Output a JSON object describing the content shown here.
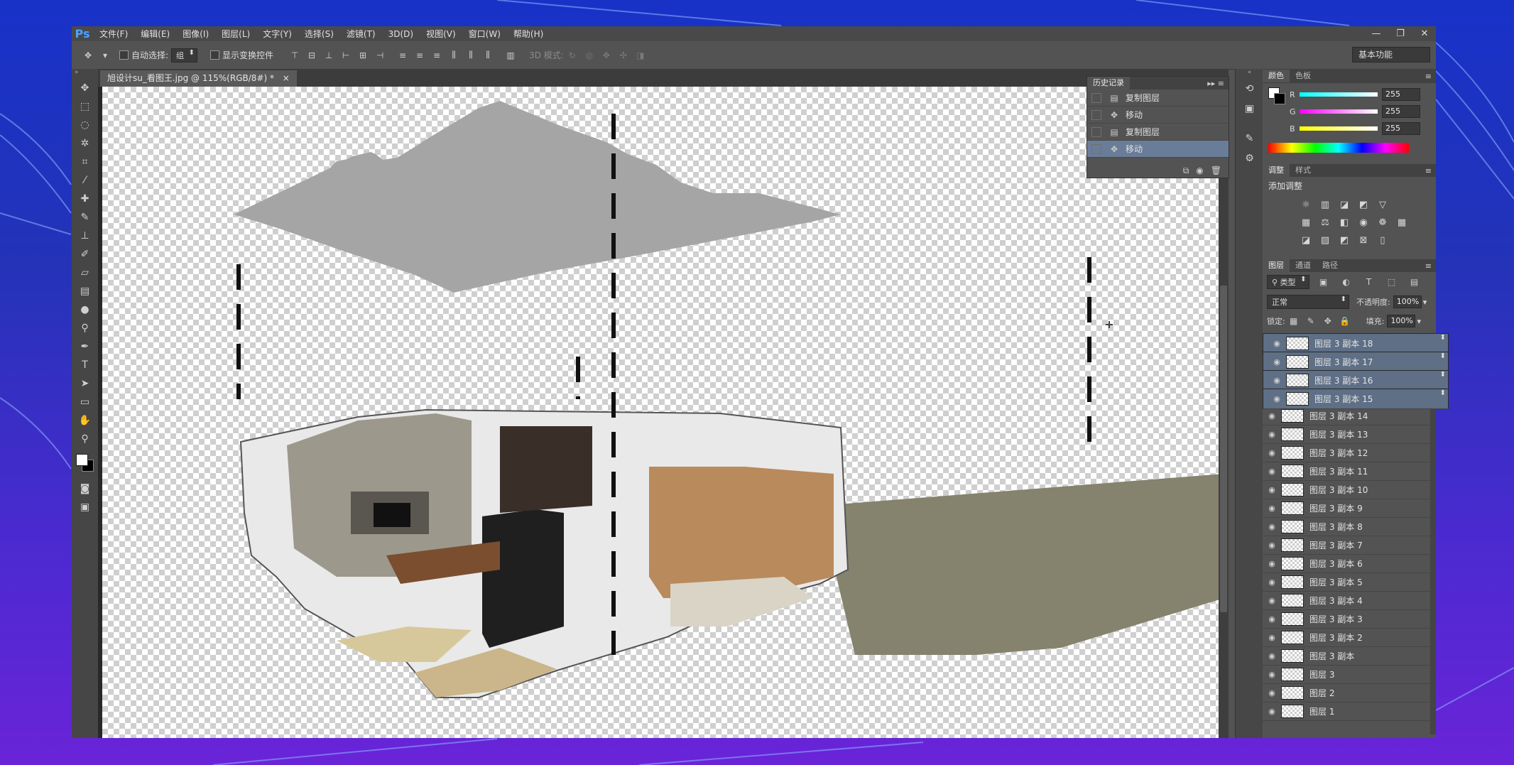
{
  "app": {
    "logo": "Ps",
    "menu": [
      "文件(F)",
      "编辑(E)",
      "图像(I)",
      "图层(L)",
      "文字(Y)",
      "选择(S)",
      "滤镜(T)",
      "3D(D)",
      "视图(V)",
      "窗口(W)",
      "帮助(H)"
    ],
    "window_controls": [
      "—",
      "❐",
      "✕"
    ]
  },
  "options_bar": {
    "auto_select_label": "自动选择:",
    "auto_select_value": "组",
    "show_transform_label": "显示变换控件",
    "mode_3d_label": "3D 模式:",
    "workspace": "基本功能"
  },
  "document": {
    "tab_title": "旭设计su_看图王.jpg @ 115%(RGB/8#) *"
  },
  "history": {
    "tab": "历史记录",
    "items": [
      {
        "label": "复制图层",
        "icon": "document-icon",
        "selected": false
      },
      {
        "label": "移动",
        "icon": "move-icon",
        "selected": false
      },
      {
        "label": "复制图层",
        "icon": "document-icon",
        "selected": false
      },
      {
        "label": "移动",
        "icon": "move-icon",
        "selected": true
      }
    ]
  },
  "color_panel": {
    "tabs": [
      "颜色",
      "色板"
    ],
    "r_label": "R",
    "g_label": "G",
    "b_label": "B",
    "r": "255",
    "g": "255",
    "b": "255"
  },
  "adjust_panel": {
    "tabs": [
      "调整",
      "样式"
    ],
    "title": "添加调整"
  },
  "layers_panel": {
    "tabs": [
      "图层",
      "通道",
      "路径"
    ],
    "filter_kind": "类型",
    "blend_mode": "正常",
    "opacity_label": "不透明度:",
    "opacity": "100%",
    "lock_label": "锁定:",
    "fill_label": "填充:",
    "fill": "100%",
    "layers": [
      {
        "name": "图层 3 副本 18",
        "selected": true
      },
      {
        "name": "图层 3 副本 17",
        "selected": true
      },
      {
        "name": "图层 3 副本 16",
        "selected": true
      },
      {
        "name": "图层 3 副本 15",
        "selected": true
      },
      {
        "name": "图层 3 副本 14",
        "selected": false
      },
      {
        "name": "图层 3 副本 13",
        "selected": false
      },
      {
        "name": "图层 3 副本 12",
        "selected": false
      },
      {
        "name": "图层 3 副本 11",
        "selected": false
      },
      {
        "name": "图层 3 副本 10",
        "selected": false
      },
      {
        "name": "图层 3 副本 9",
        "selected": false
      },
      {
        "name": "图层 3 副本 8",
        "selected": false
      },
      {
        "name": "图层 3 副本 7",
        "selected": false
      },
      {
        "name": "图层 3 副本 6",
        "selected": false
      },
      {
        "name": "图层 3 副本 5",
        "selected": false
      },
      {
        "name": "图层 3 副本 4",
        "selected": false
      },
      {
        "name": "图层 3 副本 3",
        "selected": false
      },
      {
        "name": "图层 3 副本 2",
        "selected": false
      },
      {
        "name": "图层 3 副本",
        "selected": false
      },
      {
        "name": "图层 3",
        "selected": false
      },
      {
        "name": "图层 2",
        "selected": false
      },
      {
        "name": "图层 1",
        "selected": false
      }
    ]
  },
  "colors": {
    "selection": "#6a7d98",
    "ceiling_slab": "#a5a5a5",
    "ps_blue": "#4aa3ff"
  }
}
